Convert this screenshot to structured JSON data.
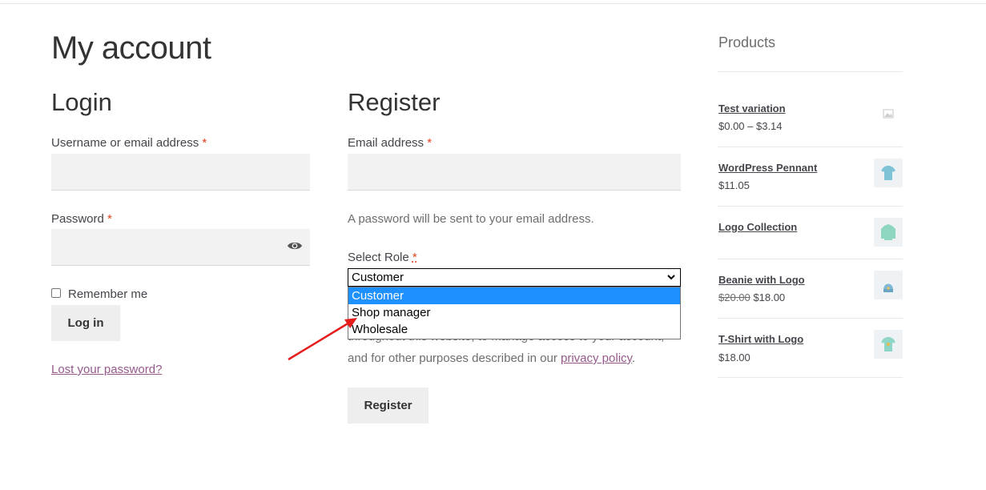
{
  "page": {
    "title": "My account"
  },
  "login": {
    "title": "Login",
    "username_label": "Username or email address",
    "password_label": "Password",
    "required_mark": "*",
    "remember_label": "Remember me",
    "login_button": "Log in",
    "lost_password": "Lost your password?"
  },
  "register": {
    "title": "Register",
    "email_label": "Email address",
    "required_mark": "*",
    "password_note": "A password will be sent to your email address.",
    "role_label": "Select Role",
    "role_required": "*",
    "role_selected": "Customer",
    "role_options": [
      "Customer",
      "Shop manager",
      "Wholesale"
    ],
    "privacy_partial": "throughout this website, to manage access to your account,",
    "privacy_line2_prefix": "and for other purposes described in our ",
    "privacy_link": "privacy policy",
    "privacy_suffix": ".",
    "register_button": "Register"
  },
  "sidebar": {
    "title": "Products",
    "products": [
      {
        "name": "Test variation",
        "price": "$0.00 – $3.14"
      },
      {
        "name": "WordPress Pennant",
        "price": "$11.05"
      },
      {
        "name": "Logo Collection",
        "price": ""
      },
      {
        "name": "Beanie with Logo",
        "old_price": "$20.00",
        "price": "$18.00"
      },
      {
        "name": "T-Shirt with Logo",
        "price": "$18.00"
      }
    ]
  },
  "colors": {
    "accent_link": "#96588a",
    "required": "#e2401c",
    "option_highlight": "#1e90ff",
    "arrow": "#e51c1c"
  }
}
